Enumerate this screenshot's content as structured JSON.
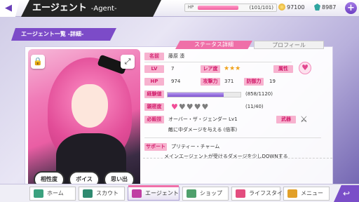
{
  "header": {
    "back_icon": "◀",
    "title": "エージェント",
    "title_en": "-Agent-",
    "hp_label": "HP",
    "hp_value": "(101/101)",
    "hp_fraction": 1.0,
    "coin_value": "97100",
    "gem_value": "8987",
    "plus_icon": "+"
  },
  "breadcrumb": "エージェント一覧 -詳細-",
  "tabs": {
    "active": "ステータス詳細",
    "inactive": "プロフィール"
  },
  "card": {
    "lock_icon": "🔒",
    "expand_icon": "⤢",
    "buttons": [
      "相性度",
      "ボイス",
      "思い出"
    ]
  },
  "status": {
    "name_label": "名前",
    "name_value": "藤原 湊",
    "lv_label": "LV",
    "lv_value": "7",
    "rarity_label": "レア度",
    "rarity_stars": "★★★",
    "attribute_label": "属性",
    "attribute_icon": "♥",
    "hp_label": "HP",
    "hp_value": "974",
    "attack_label": "攻撃力",
    "attack_value": "371",
    "defense_label": "防御力",
    "defense_value": "19",
    "exp_label": "経験値",
    "exp_value": "(858/1120)",
    "exp_fraction": 0.766,
    "affinity_label": "親密度",
    "affinity_value": "(11/40)",
    "affinity_hearts_on": 1,
    "affinity_hearts_total": 5,
    "skill_label": "必殺技",
    "skill_value": "オーバー・ザ・ジェンダー Lv1",
    "skill_desc": "敵に中ダメージを与える (倍率)",
    "weapon_label": "武器",
    "weapon_icon": "⚔",
    "support_label": "サポート",
    "support_value": "プリティー・チャーム",
    "support_desc": "メインエージェントが受けるダメージを少しDOWNする"
  },
  "nav": {
    "items": [
      {
        "label": "ホーム",
        "icon": "home-icon",
        "color": "#3aa17e"
      },
      {
        "label": "スカウト",
        "icon": "scout-icon",
        "color": "#2f8a70"
      },
      {
        "label": "エージェント",
        "icon": "agent-icon",
        "color": "#c03fa3"
      },
      {
        "label": "ショップ",
        "icon": "shop-icon",
        "color": "#4fa06b"
      },
      {
        "label": "ライフスタイル",
        "icon": "lifestyle-icon",
        "color": "#e34d7e"
      },
      {
        "label": "メニュー",
        "icon": "menu-icon",
        "color": "#e2a028"
      }
    ],
    "back_icon": "↩"
  }
}
